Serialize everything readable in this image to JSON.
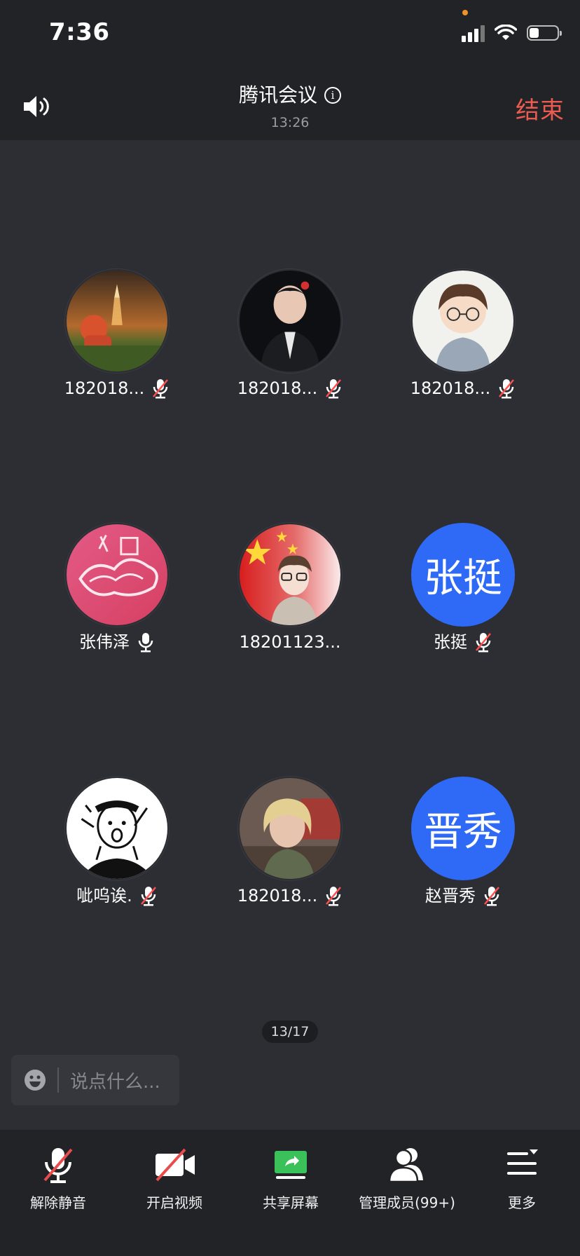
{
  "status_bar": {
    "time": "7:36"
  },
  "header": {
    "title": "腾讯会议",
    "duration": "13:26",
    "end_label": "结束"
  },
  "participants": [
    {
      "name": "182018...",
      "avatar": "rocket-astronaut-photo",
      "mic": "muted"
    },
    {
      "name": "182018...",
      "avatar": "portrait-photo-black-jacket",
      "mic": "muted"
    },
    {
      "name": "182018...",
      "avatar": "cartoon-boy-glasses",
      "mic": "muted"
    },
    {
      "name": "张伟泽",
      "avatar": "red-cloud-pattern",
      "mic": "on"
    },
    {
      "name": "18201123...",
      "avatar": "china-flag-cartoon",
      "mic": "none"
    },
    {
      "name": "张挺",
      "avatar_text": "张挺",
      "mic": "muted"
    },
    {
      "name": "呲呜诶.",
      "avatar": "cartoon-sketch",
      "mic": "muted"
    },
    {
      "name": "182018...",
      "avatar": "blonde-portrait-photo",
      "mic": "muted"
    },
    {
      "name": "赵晋秀",
      "avatar_text": "晋秀",
      "mic": "muted"
    }
  ],
  "page_indicator": "13/17",
  "chat": {
    "placeholder": "说点什么..."
  },
  "toolbar": {
    "unmute_label": "解除静音",
    "video_label": "开启视频",
    "share_label": "共享屏幕",
    "members_label": "管理成员(99+)",
    "more_label": "更多"
  },
  "colors": {
    "end_red": "#ec5b4f",
    "text_avatar_blue": "#2e6af6",
    "share_green": "#3bc15a",
    "background": "#2c2e33"
  }
}
